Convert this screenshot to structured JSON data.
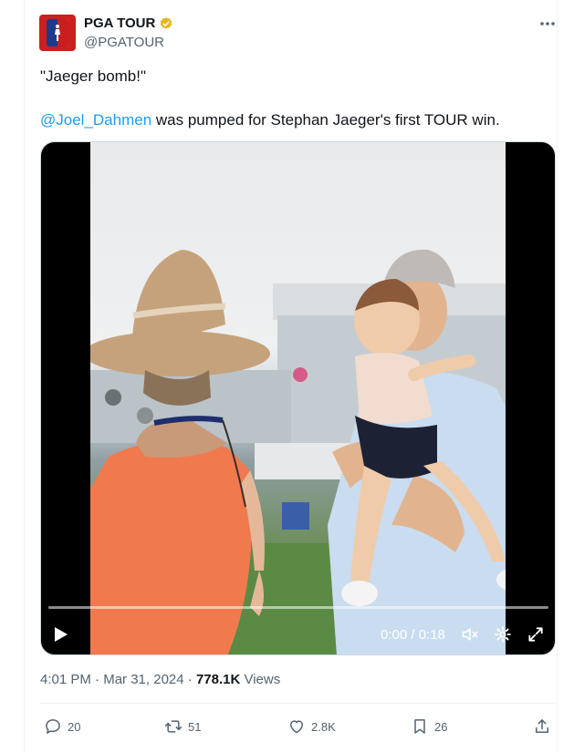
{
  "account": {
    "display_name": "PGA TOUR",
    "handle": "@PGATOUR",
    "verified_badge_icon": "verified-gold-badge-icon",
    "avatar_icon": "pga-tour-logo-icon",
    "brand_color": "#cc1f1f"
  },
  "tweet": {
    "line1": "\"Jaeger bomb!\"",
    "mention": "@Joel_Dahmen",
    "line2_rest": " was pumped for Stephan Jaeger's first TOUR win."
  },
  "video": {
    "time": "0:00 / 0:18"
  },
  "meta": {
    "time": "4:01 PM",
    "sep1": " · ",
    "date": "Mar 31, 2024",
    "sep2": " · ",
    "views_count": "778.1K",
    "views_label": " Views"
  },
  "actions": {
    "replies": "20",
    "reposts": "51",
    "likes": "2.8K",
    "bookmarks": "26"
  },
  "colors": {
    "link": "#1d9bf0",
    "secondary_text": "#536471",
    "primary_text": "#0f1419"
  }
}
